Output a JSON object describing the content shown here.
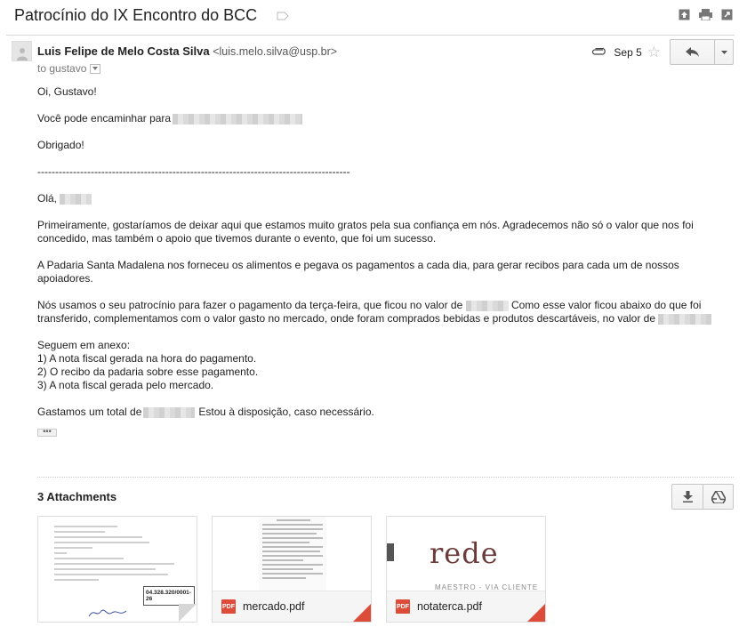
{
  "subject": "Patrocínio do IX Encontro do BCC",
  "sender": {
    "name": "Luis Felipe de Melo Costa Silva",
    "email": "<luis.melo.silva@usp.br>",
    "to": "to gustavo"
  },
  "meta": {
    "date": "Sep 5"
  },
  "body": {
    "greeting": "Oi, Gustavo!",
    "forward": "Você pode encaminhar para",
    "thanks": "Obrigado!",
    "separator": "----------------------------------------------------------------------------------------",
    "hello": "Olá,",
    "p1": "Primeiramente, gostaríamos de deixar aqui que estamos muito gratos pela sua confiança em nós. Agradecemos não só o valor que nos foi concedido, mas também o apoio que tivemos durante o evento, que foi um sucesso.",
    "p2": "A Padaria Santa Madalena nos forneceu os alimentos e pegava os pagamentos a cada dia, para gerar recibos para cada um de nossos apoiadores.",
    "p3a": "Nós usamos o seu patrocínio para fazer o pagamento da terça-feira, que ficou no valor de",
    "p3b": "Como esse valor ficou abaixo do que foi transferido, complementamos com o valor gasto no mercado, onde foram comprados bebidas e produtos descartáveis, no valor de",
    "annex_intro": "Seguem em anexo:",
    "annex_1": "1) A nota fiscal gerada na hora do pagamento.",
    "annex_2": "2) O recibo da padaria sobre esse pagamento.",
    "annex_3": "3) A nota fiscal gerada pelo mercado.",
    "total_a": "Gastamos um total de",
    "total_b": "Estou à disposição, caso necessário.",
    "ellipsis": "•••"
  },
  "attachments": {
    "title": "3 Attachments",
    "files": [
      {
        "name": "",
        "type": "PDF"
      },
      {
        "name": "mercado.pdf",
        "type": "PDF"
      },
      {
        "name": "notaterca.pdf",
        "type": "PDF"
      }
    ],
    "preview_rede": "rede",
    "preview_rede_sub": "MAESTRO - VIA CLIENTE",
    "preview_total": "04.328.320/0001-26"
  },
  "icons": {
    "label": "label-icon",
    "expand": "expand-icon",
    "print": "print-icon",
    "popout": "popout-icon",
    "attachment": "paperclip-icon",
    "star": "star-icon",
    "reply": "reply-icon",
    "more": "chevron-down-icon",
    "download": "download-icon",
    "drive": "drive-icon",
    "pdf": "pdf-icon"
  },
  "colors": {
    "pdf_red": "#dd4b39",
    "text": "#222222",
    "muted": "#777777"
  }
}
